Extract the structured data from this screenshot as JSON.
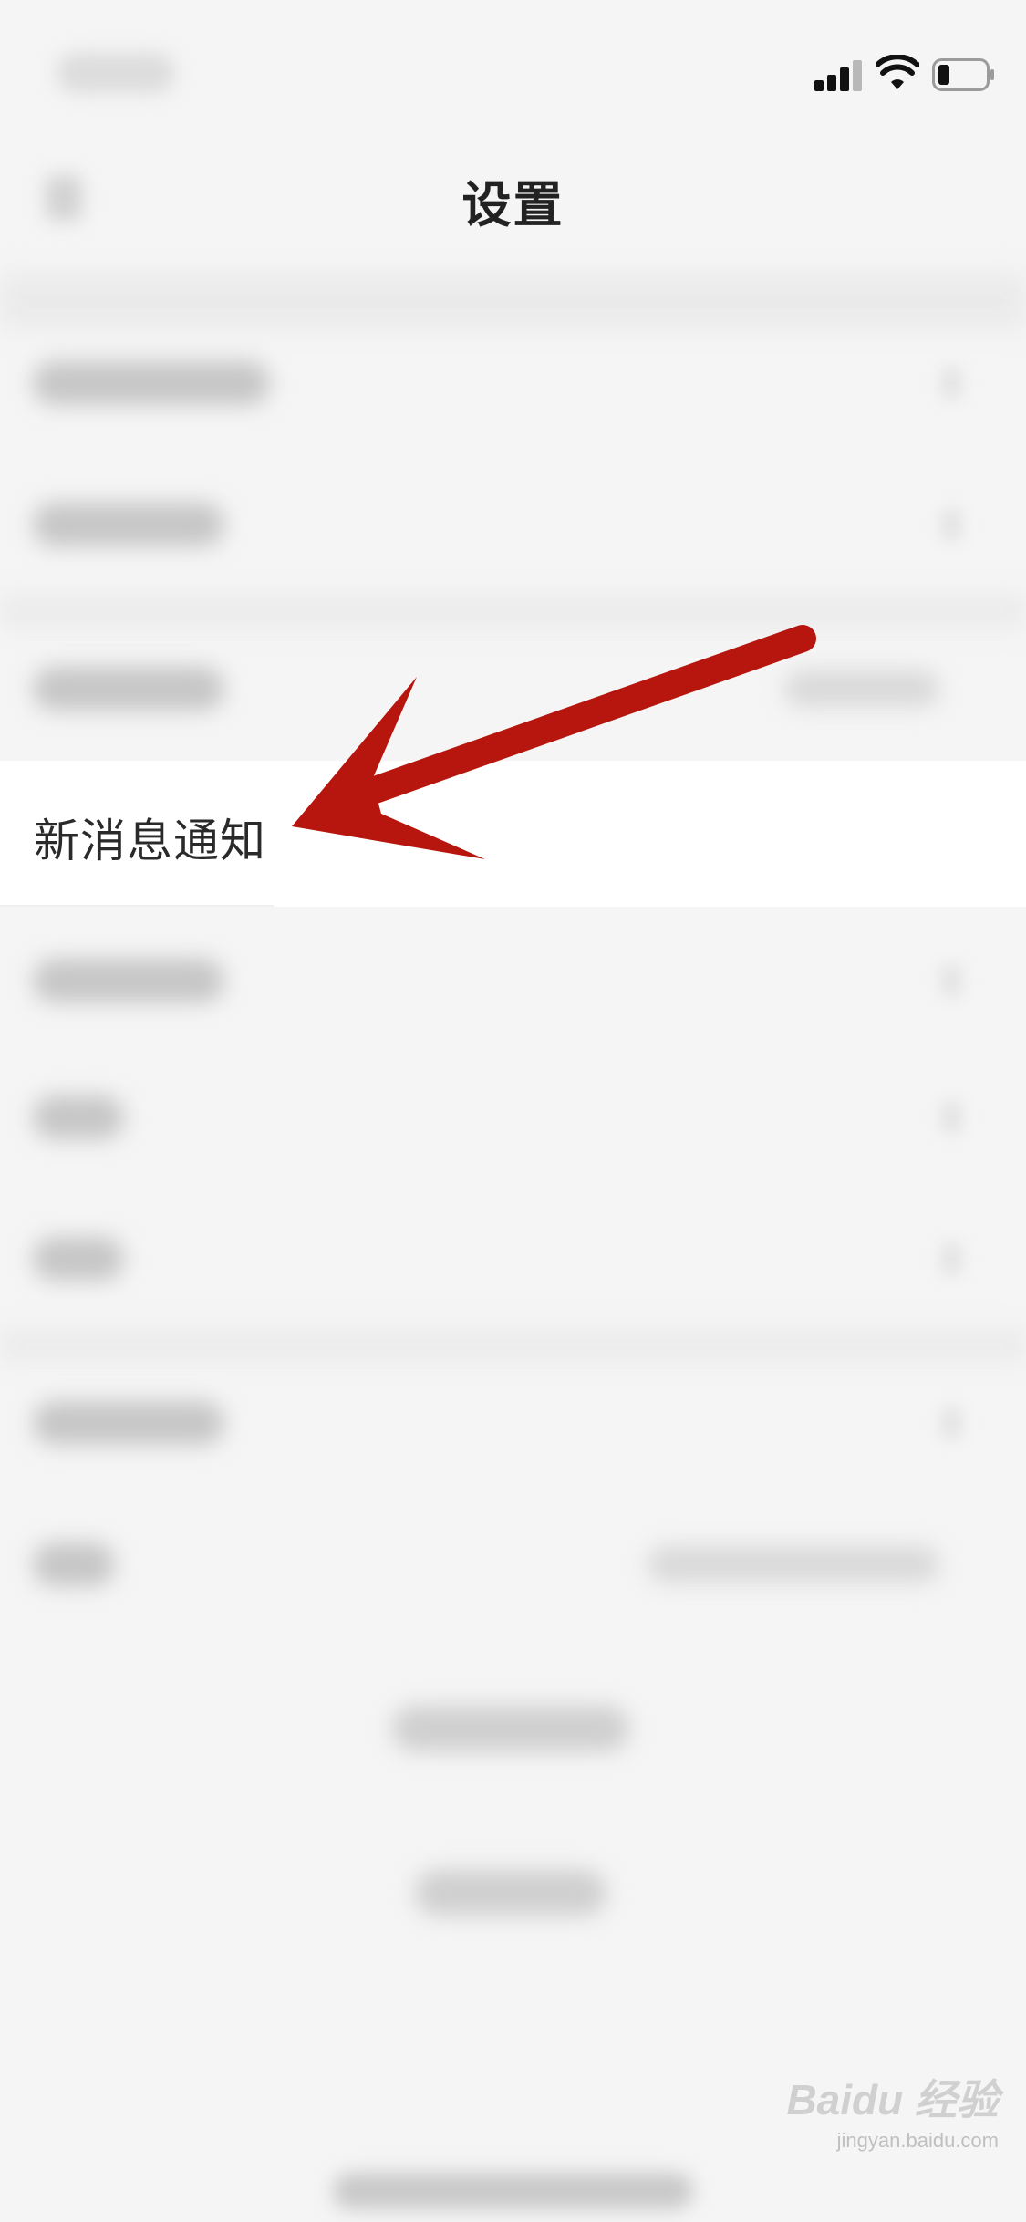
{
  "nav": {
    "title": "设置"
  },
  "settings": {
    "highlighted_item_label": "新消息通知"
  },
  "watermark": {
    "brand": "Baidu 经验",
    "url": "jingyan.baidu.com"
  },
  "annotation": {
    "arrow_color": "#b7160e"
  },
  "icons": [
    "signal-icon",
    "wifi-icon",
    "battery-icon",
    "arrow-annotation-icon"
  ]
}
